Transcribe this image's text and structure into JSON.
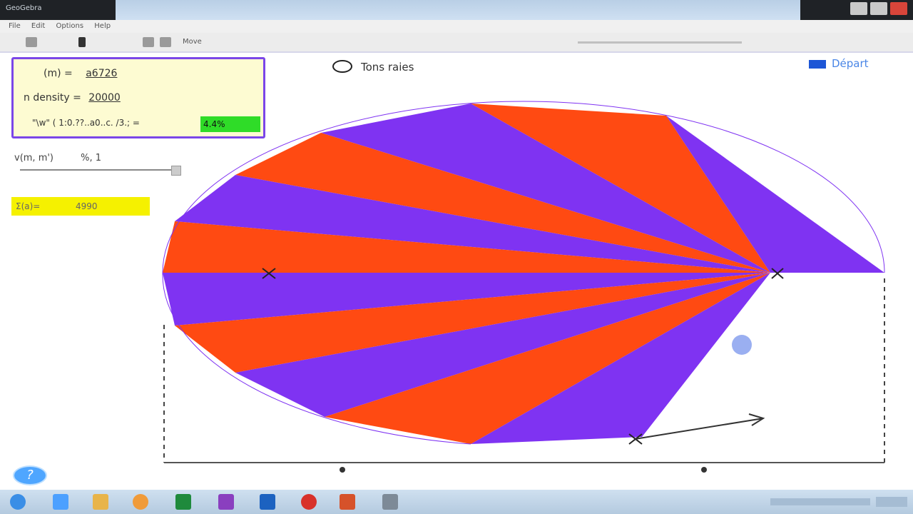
{
  "window": {
    "title": "GeoGebra"
  },
  "menu": {
    "items": [
      "File",
      "Edit",
      "Options",
      "Help"
    ]
  },
  "toolbar": {
    "zoom_label": "Move"
  },
  "info": {
    "line1_label": "(m) =",
    "line1_value": "a6726",
    "line2_label": "n density =",
    "line2_value": "20000",
    "line3_label": "\"\\w\" ( 1:0.??..a0..c. /3.; =",
    "line3_value": "4.4%"
  },
  "slider": {
    "label": "v(m, m')",
    "value": "%, 1"
  },
  "yellow": {
    "name": "Σ(a)=",
    "value": "4990"
  },
  "radio": {
    "label": "Tons raies"
  },
  "toggle": {
    "label": "Départ"
  },
  "help": {
    "glyph": "?"
  },
  "colors": {
    "red": "#ff4a12",
    "purple": "#7f33f2",
    "accent": "#7b46e8",
    "green": "#2fdc28",
    "yellow": "#f5f100"
  }
}
